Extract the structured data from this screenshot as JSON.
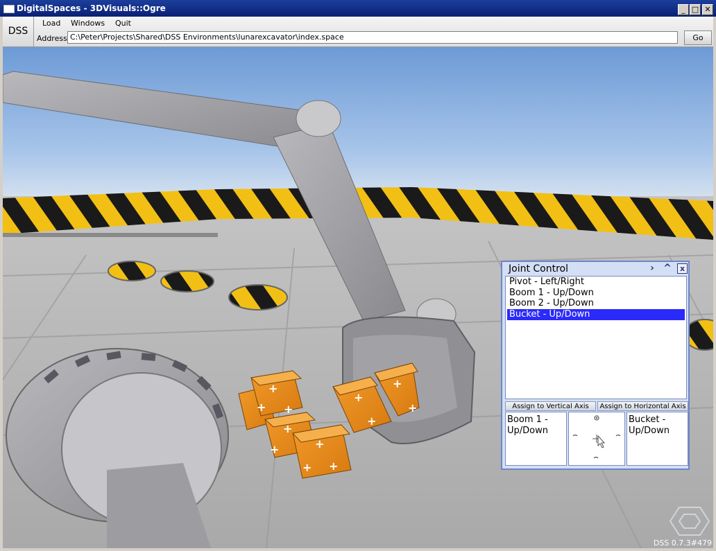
{
  "window": {
    "title": "DigitalSpaces - 3DVisuals::Ogre",
    "minimize_label": "_",
    "maximize_label": "□",
    "close_label": "✕"
  },
  "app": {
    "dss_label": "DSS"
  },
  "menu": {
    "items": [
      "Load",
      "Windows",
      "Quit"
    ]
  },
  "address": {
    "label": "Address:",
    "value": "C:\\Peter\\Projects\\Shared\\DSS Environments\\lunarexcavator\\index.space",
    "go_label": "Go"
  },
  "joint_control": {
    "title": "Joint Control",
    "next_label": "›",
    "up_label": "^",
    "close_label": "x",
    "joints": [
      {
        "label": "Pivot - Left/Right",
        "selected": false
      },
      {
        "label": "Boom 1 - Up/Down",
        "selected": false
      },
      {
        "label": "Boom 2 - Up/Down",
        "selected": false
      },
      {
        "label": "Bucket - Up/Down",
        "selected": true
      }
    ],
    "assign_vertical_label": "Assign to Vertical Axis",
    "assign_horizontal_label": "Assign to Horizontal Axis",
    "vertical_assignment": "Boom 1 - Up/Down",
    "horizontal_assignment": "Bucket - Up/Down"
  },
  "status": {
    "version": "DSS 0.7.3#479"
  },
  "colors": {
    "title_bar": "#0a2a8a",
    "selection": "#2a2afa",
    "panel_bg": "#d2dff5",
    "box_orange": "#e98b1e",
    "hazard_yellow": "#f2c014"
  }
}
